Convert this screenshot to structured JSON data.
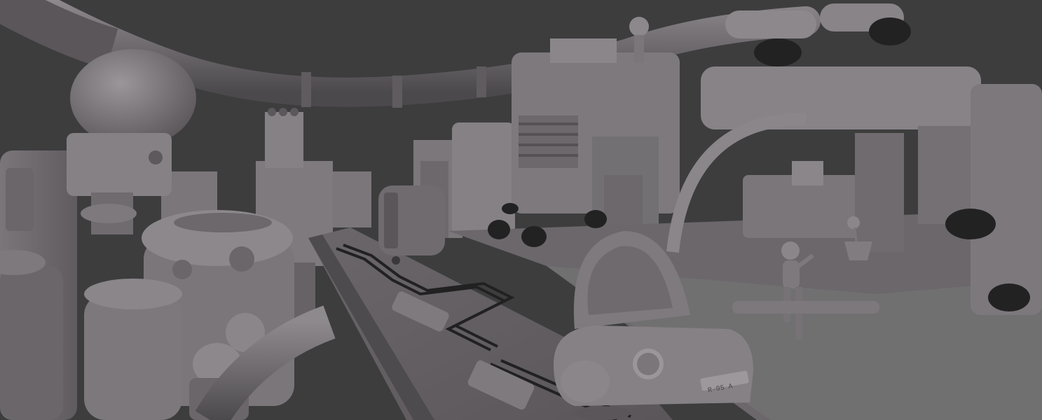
{
  "scene": {
    "background_color": "#3d3d3e",
    "clay_color": "#6f6b6f",
    "clay_light": "#8a868a",
    "clay_dark": "#4f4b4f",
    "planter_color": "#232223"
  },
  "car": {
    "plate_text": "R-05 A"
  }
}
